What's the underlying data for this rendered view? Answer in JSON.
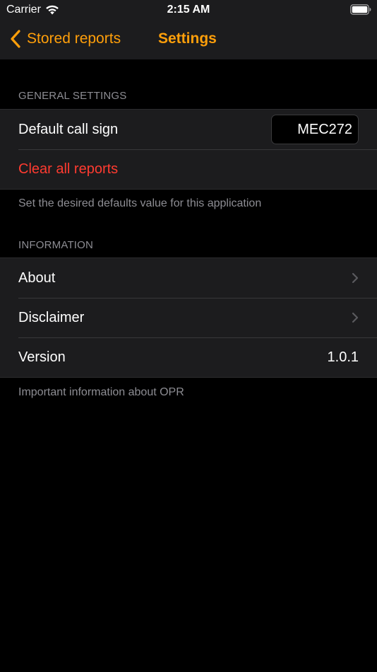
{
  "status_bar": {
    "carrier": "Carrier",
    "time": "2:15 AM"
  },
  "nav": {
    "back_label": "Stored reports",
    "title": "Settings"
  },
  "general": {
    "header": "GENERAL SETTINGS",
    "call_sign_label": "Default call sign",
    "call_sign_value": "MEC272",
    "clear_label": "Clear all reports",
    "footer": "Set the desired defaults value for this application"
  },
  "information": {
    "header": "INFORMATION",
    "about_label": "About",
    "disclaimer_label": "Disclaimer",
    "version_label": "Version",
    "version_value": "1.0.1",
    "footer": "Important information about OPR"
  },
  "colors": {
    "accent": "#ff9f0a",
    "destructive": "#ff3b30",
    "background": "#000000",
    "cell_background": "#1c1c1e",
    "secondary_text": "#8d8d93"
  },
  "icons": {
    "wifi": "wifi-icon",
    "battery": "battery-icon",
    "back": "chevron-left-icon",
    "disclosure": "chevron-right-icon"
  }
}
